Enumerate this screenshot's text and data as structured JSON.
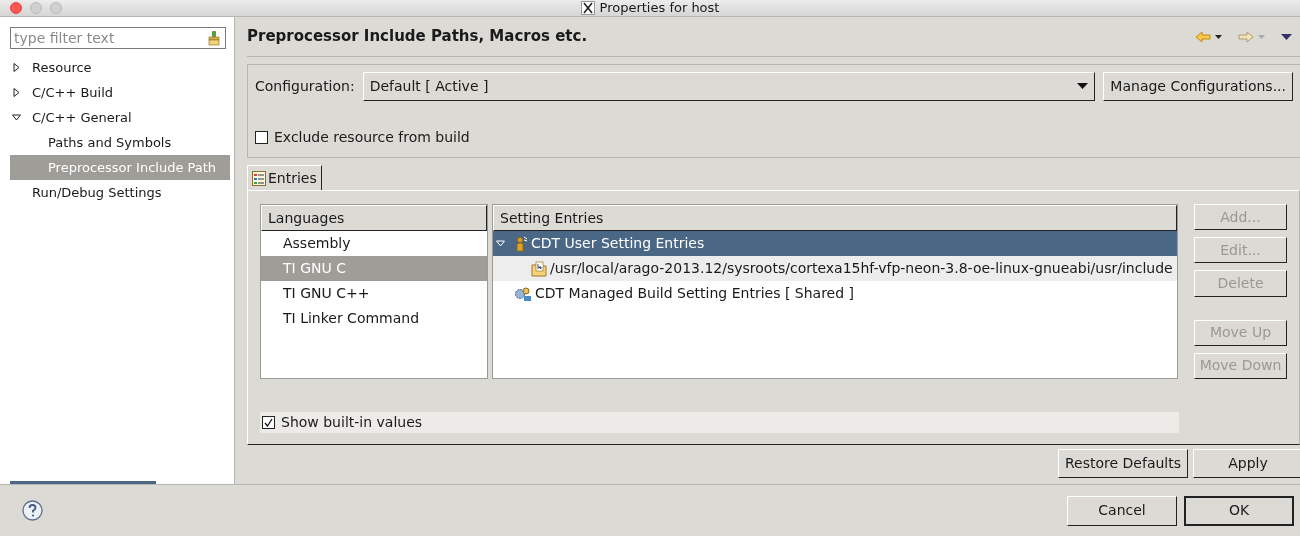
{
  "window": {
    "title": "Properties for host"
  },
  "filter": {
    "placeholder": "type filter text"
  },
  "tree": [
    {
      "label": "Resource",
      "expanded": false,
      "selected": false
    },
    {
      "label": "C/C++ Build",
      "expanded": false,
      "selected": false
    },
    {
      "label": "C/C++ General",
      "expanded": true,
      "selected": false,
      "children": [
        {
          "label": "Paths and Symbols",
          "selected": false
        },
        {
          "label": "Preprocessor Include Path",
          "selected": true
        }
      ]
    },
    {
      "label": "Run/Debug Settings",
      "selected": false
    }
  ],
  "page": {
    "title": "Preprocessor Include Paths, Macros etc."
  },
  "configuration": {
    "label": "Configuration:",
    "value": "Default  [ Active ]",
    "manage_button": "Manage Configurations..."
  },
  "exclude": {
    "label": "Exclude resource from build",
    "checked": false
  },
  "tabs": [
    {
      "label": "Entries",
      "selected": true
    }
  ],
  "languages": {
    "header": "Languages",
    "items": [
      {
        "label": "Assembly",
        "selected": false
      },
      {
        "label": "TI GNU C",
        "selected": true
      },
      {
        "label": "TI GNU C++",
        "selected": false
      },
      {
        "label": "TI Linker Command",
        "selected": false
      }
    ]
  },
  "entries": {
    "header": "Setting Entries",
    "items": [
      {
        "kind": "user",
        "label": "CDT User Setting Entries",
        "expanded": true,
        "selected": true,
        "highlighted": false,
        "children": [
          {
            "kind": "include",
            "label": "/usr/local/arago-2013.12/sysroots/cortexa15hf-vfp-neon-3.8-oe-linux-gnueabi/usr/include",
            "selected": false,
            "highlighted": true
          }
        ]
      },
      {
        "kind": "managed",
        "label": "CDT Managed Build Setting Entries   [ Shared ]",
        "selected": false,
        "highlighted": false
      }
    ]
  },
  "side_buttons": [
    {
      "label": "Add...",
      "disabled": true,
      "gap_before": false
    },
    {
      "label": "Edit...",
      "disabled": true,
      "gap_before": false
    },
    {
      "label": "Delete",
      "disabled": true,
      "gap_before": false
    },
    {
      "label": "Move Up",
      "disabled": true,
      "gap_before": true
    },
    {
      "label": "Move Down",
      "disabled": true,
      "gap_before": false
    }
  ],
  "show_builtin": {
    "label": "Show built-in values",
    "checked": true
  },
  "page_buttons": [
    "Restore Defaults",
    "Apply"
  ],
  "dialog_buttons": [
    {
      "label": "Cancel",
      "default": false
    },
    {
      "label": "OK",
      "default": true
    }
  ]
}
